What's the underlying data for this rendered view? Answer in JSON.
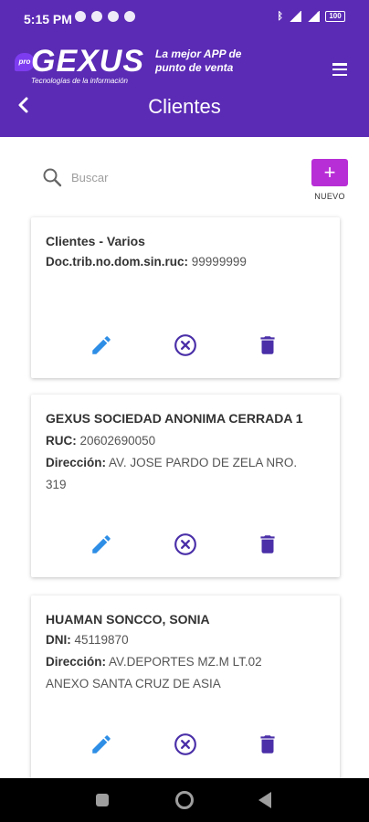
{
  "status_bar": {
    "time": "5:15 PM",
    "battery": "100"
  },
  "header": {
    "logo_badge": "pro",
    "logo_word": "GEXUS",
    "logo_tagline": "Tecnologías de la información",
    "slogan_line1": "La mejor APP de",
    "slogan_line2": "punto de venta",
    "title": "Clientes"
  },
  "search": {
    "placeholder": "Buscar",
    "value": ""
  },
  "new_button": {
    "icon": "+",
    "label": "NUEVO"
  },
  "clients": [
    {
      "name": "Clientes - Varios",
      "doc_label": "Doc.trib.no.dom.sin.ruc:",
      "doc_value": "99999999"
    },
    {
      "name": "GEXUS SOCIEDAD ANONIMA CERRADA 1",
      "doc_label": "RUC:",
      "doc_value": "20602690050",
      "address_label": "Dirección:",
      "address_line1": "AV. JOSE PARDO DE ZELA NRO.",
      "address_line2": "319"
    },
    {
      "name": "HUAMAN SONCCO, SONIA",
      "doc_label": "DNI:",
      "doc_value": "45119870",
      "address_label": "Dirección:",
      "address_line1": "AV.DEPORTES MZ.M LT.02",
      "address_line2": "ANEXO SANTA CRUZ DE ASIA"
    }
  ],
  "icons": {
    "edit": "pencil-icon",
    "cancel": "circle-x-icon",
    "delete": "trash-icon",
    "back": "chevron-left-icon",
    "menu": "hamburger-menu-icon",
    "search": "search-icon"
  },
  "colors": {
    "primary": "#5b2bb5",
    "accent": "#b82ed6",
    "edit": "#2e8ee6",
    "action": "#4a2fa8"
  }
}
